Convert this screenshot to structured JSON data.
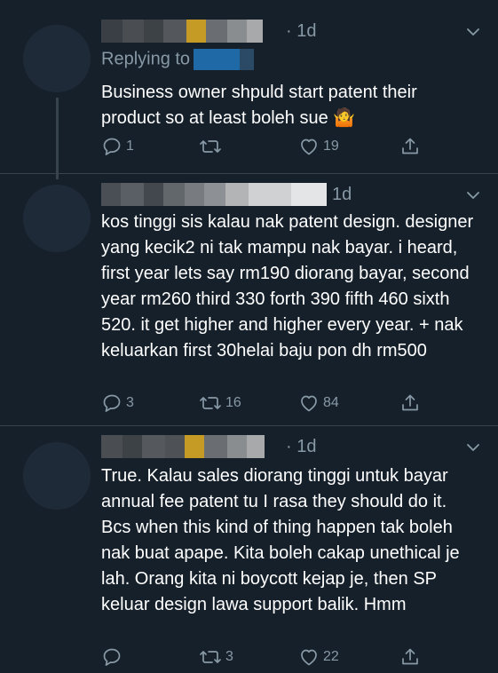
{
  "colors": {
    "background": "#15202b",
    "muted": "#8899a6",
    "divider": "#38444d",
    "text": "#ffffff"
  },
  "tweets": [
    {
      "time": "· 1d",
      "replying_to": "Replying to",
      "text": "Business owner shpuld start patent their product so at least boleh sue 🤷",
      "replies": "1",
      "retweets": "",
      "likes": "19"
    },
    {
      "time": "1d",
      "text": "kos tinggi sis kalau nak patent design. designer yang kecik2 ni tak mampu nak bayar. i heard, first year lets say rm190 diorang bayar, second year rm260 third 330 forth 390 fifth 460 sixth 520. it get higher and higher every year. + nak keluarkan first 30helai baju pon dh rm500",
      "replies": "3",
      "retweets": "16",
      "likes": "84"
    },
    {
      "time": "· 1d",
      "text": "True. Kalau sales diorang tinggi untuk bayar annual fee patent tu I rasa they should do it. Bcs when this kind of thing happen tak boleh nak buat apape. Kita boleh cakap unethical je lah. Orang kita ni boycott kejap je, then SP keluar design lawa support balik. Hmm",
      "replies": "",
      "retweets": "3",
      "likes": "22"
    }
  ],
  "icons": {
    "reply": "reply-icon",
    "retweet": "retweet-icon",
    "like": "heart-icon",
    "share": "share-icon",
    "more": "chevron-down-icon"
  }
}
